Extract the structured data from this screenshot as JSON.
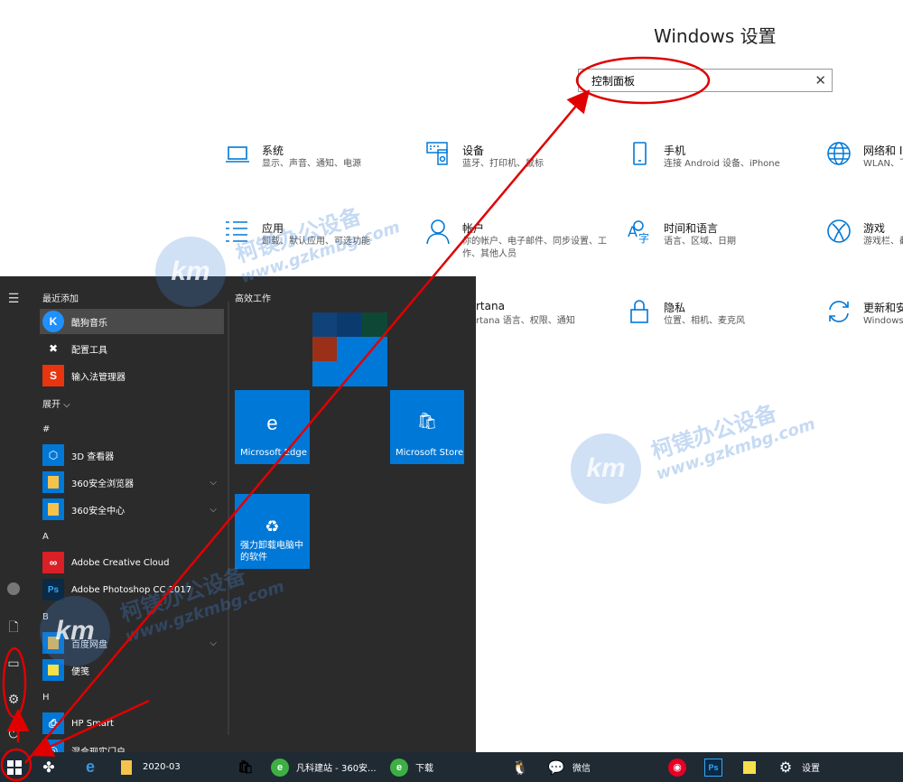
{
  "settings": {
    "title": "Windows 设置",
    "search_value": "控制面板",
    "items": [
      {
        "name": "系统",
        "desc": "显示、声音、通知、电源",
        "icon": "laptop-icon"
      },
      {
        "name": "设备",
        "desc": "蓝牙、打印机、鼠标",
        "icon": "keyboard-icon"
      },
      {
        "name": "手机",
        "desc": "连接 Android 设备、iPhone",
        "icon": "phone-icon"
      },
      {
        "name": "网络和 In",
        "desc": "WLAN、飞",
        "icon": "globe-icon"
      },
      {
        "name": "应用",
        "desc": "卸载、默认应用、可选功能",
        "icon": "apps-list-icon"
      },
      {
        "name": "帐户",
        "desc": "你的帐户、电子邮件、同步设置、工作、其他人员",
        "icon": "person-icon"
      },
      {
        "name": "时间和语言",
        "desc": "语言、区域、日期",
        "icon": "time-language-icon"
      },
      {
        "name": "游戏",
        "desc": "游戏栏、截",
        "icon": "xbox-icon"
      },
      {
        "name": "rtana",
        "desc": "rtana 语言、权限、通知",
        "icon": "cortana-icon"
      },
      {
        "name": "隐私",
        "desc": "位置、相机、麦克风",
        "icon": "lock-icon"
      },
      {
        "name": "更新和安",
        "desc": "Windows",
        "icon": "sync-icon"
      }
    ]
  },
  "start_menu": {
    "recent_header": "最近添加",
    "expand_label": "展开",
    "tiles_header": "高效工作",
    "apps": [
      {
        "label": "酷狗音乐",
        "icon": "kugou-icon",
        "color": "#1e90ff"
      },
      {
        "label": "配置工具",
        "icon": "tools-icon",
        "color": "#2b2b2b"
      },
      {
        "label": "输入法管理器",
        "icon": "sogou-icon",
        "color": "#e8340f"
      },
      {
        "label": "3D 查看器",
        "icon": "cube-icon",
        "color": "#0078d7"
      },
      {
        "label": "360安全浏览器",
        "icon": "folder-icon",
        "color": "#0078d7"
      },
      {
        "label": "360安全中心",
        "icon": "folder-icon",
        "color": "#0078d7"
      },
      {
        "label": "Adobe Creative Cloud",
        "icon": "creative-cloud-icon",
        "color": "#da1f26"
      },
      {
        "label": "Adobe Photoshop CC 2017",
        "icon": "photoshop-icon",
        "color": "#0a2a45"
      },
      {
        "label": "百度网盘",
        "icon": "folder-icon",
        "color": "#0078d7"
      },
      {
        "label": "便笺",
        "icon": "sticky-note-icon",
        "color": "#0078d7"
      },
      {
        "label": "HP Smart",
        "icon": "printer-icon",
        "color": "#0078d7"
      },
      {
        "label": "混合现实门户",
        "icon": "mixed-reality-icon",
        "color": "#0078d7"
      }
    ],
    "sections": [
      "#",
      "A",
      "B",
      "H"
    ],
    "tiles": [
      {
        "label": "Microsoft Edge",
        "icon": "edge-icon"
      },
      {
        "label": "Microsoft Store",
        "icon": "store-icon"
      },
      {
        "label": "强力卸载电脑中的软件",
        "icon": "uninstall-icon"
      }
    ]
  },
  "taskbar": {
    "items": [
      {
        "label": "",
        "icon": "windows-start-icon"
      },
      {
        "label": "",
        "icon": "pinwheel-icon"
      },
      {
        "label": "",
        "icon": "edge-icon"
      },
      {
        "label": "2020-03",
        "icon": "folder-icon"
      },
      {
        "label": "",
        "icon": "store-icon"
      },
      {
        "label": "凡科建站 - 360安...",
        "icon": "360-browser-icon"
      },
      {
        "label": "下载",
        "icon": "360-browser-icon"
      },
      {
        "label": "",
        "icon": "qq-icon"
      },
      {
        "label": "微信",
        "icon": "wechat-icon"
      },
      {
        "label": "",
        "icon": "netease-music-icon"
      },
      {
        "label": "",
        "icon": "photoshop-icon"
      },
      {
        "label": "",
        "icon": "sticky-note-icon"
      },
      {
        "label": "设置",
        "icon": "gear-icon"
      }
    ]
  },
  "watermark": {
    "logo": "km",
    "cn": "柯镁办公设备",
    "en": "www.gzkmbg.com"
  },
  "colors": {
    "accent": "#0078d7",
    "start_bg": "#2b2b2b",
    "taskbar_bg": "#1f2a33",
    "annotation": "#e00000"
  }
}
